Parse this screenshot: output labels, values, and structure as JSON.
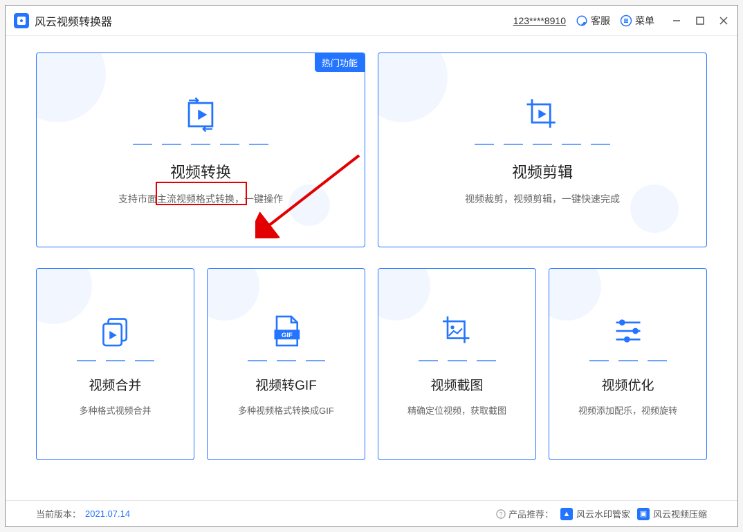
{
  "header": {
    "app_title": "风云视频转换器",
    "phone": "123****8910",
    "support_label": "客服",
    "menu_label": "菜单"
  },
  "cards": {
    "convert": {
      "badge": "热门功能",
      "title": "视频转换",
      "desc": "支持市面主流视频格式转换，一键操作"
    },
    "edit": {
      "title": "视频剪辑",
      "desc": "视频裁剪，视频剪辑，一键快速完成"
    },
    "merge": {
      "title": "视频合并",
      "desc": "多种格式视频合并"
    },
    "gif": {
      "title": "视频转GIF",
      "desc": "多种视频格式转换成GIF",
      "badge_text": "GIF"
    },
    "shot": {
      "title": "视频截图",
      "desc": "精确定位视频，获取截图"
    },
    "opt": {
      "title": "视频优化",
      "desc": "视频添加配乐，视频旋转"
    }
  },
  "footer": {
    "version_label": "当前版本：",
    "version_value": "2021.07.14",
    "recommend_label": "产品推荐：",
    "rec1": "风云水印管家",
    "rec2": "风云视频压缩"
  }
}
